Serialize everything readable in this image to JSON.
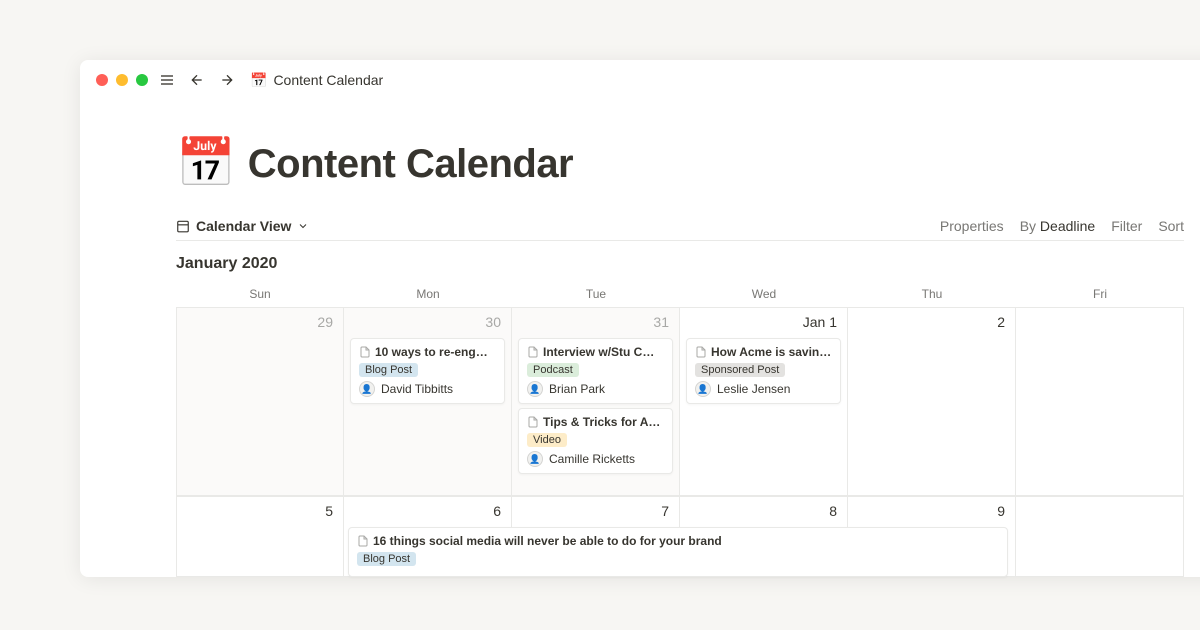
{
  "titlebar": {
    "page_label": "Content Calendar"
  },
  "page": {
    "emoji": "📅",
    "title": "Content Calendar"
  },
  "view": {
    "label": "Calendar View",
    "controls": {
      "properties": "Properties",
      "by_prefix": "By ",
      "by_value": "Deadline",
      "filter": "Filter",
      "sort": "Sort"
    }
  },
  "month": "January 2020",
  "dayheads": [
    "Sun",
    "Mon",
    "Tue",
    "Wed",
    "Thu",
    "Fri"
  ],
  "week1": {
    "days": [
      "29",
      "30",
      "31",
      "Jan 1",
      "2",
      ""
    ],
    "events": {
      "mon": {
        "title": "10 ways to re-eng…",
        "tag": "Blog Post",
        "tag_class": "tag-blogpost",
        "assignee": "David Tibbitts"
      },
      "tue_a": {
        "title": "Interview w/Stu C…",
        "tag": "Podcast",
        "tag_class": "tag-podcast",
        "assignee": "Brian Park"
      },
      "tue_b": {
        "title": "Tips & Tricks for A…",
        "tag": "Video",
        "tag_class": "tag-video",
        "assignee": "Camille Ricketts"
      },
      "wed": {
        "title": "How Acme is savin…",
        "tag": "Sponsored Post",
        "tag_class": "tag-sponsored",
        "assignee": "Leslie Jensen"
      }
    }
  },
  "week2": {
    "days": [
      "5",
      "6",
      "7",
      "8",
      "9",
      ""
    ],
    "spanning": {
      "title": "16 things social media will never be able to do for your brand",
      "tag": "Blog Post",
      "tag_class": "tag-blogpost"
    }
  }
}
